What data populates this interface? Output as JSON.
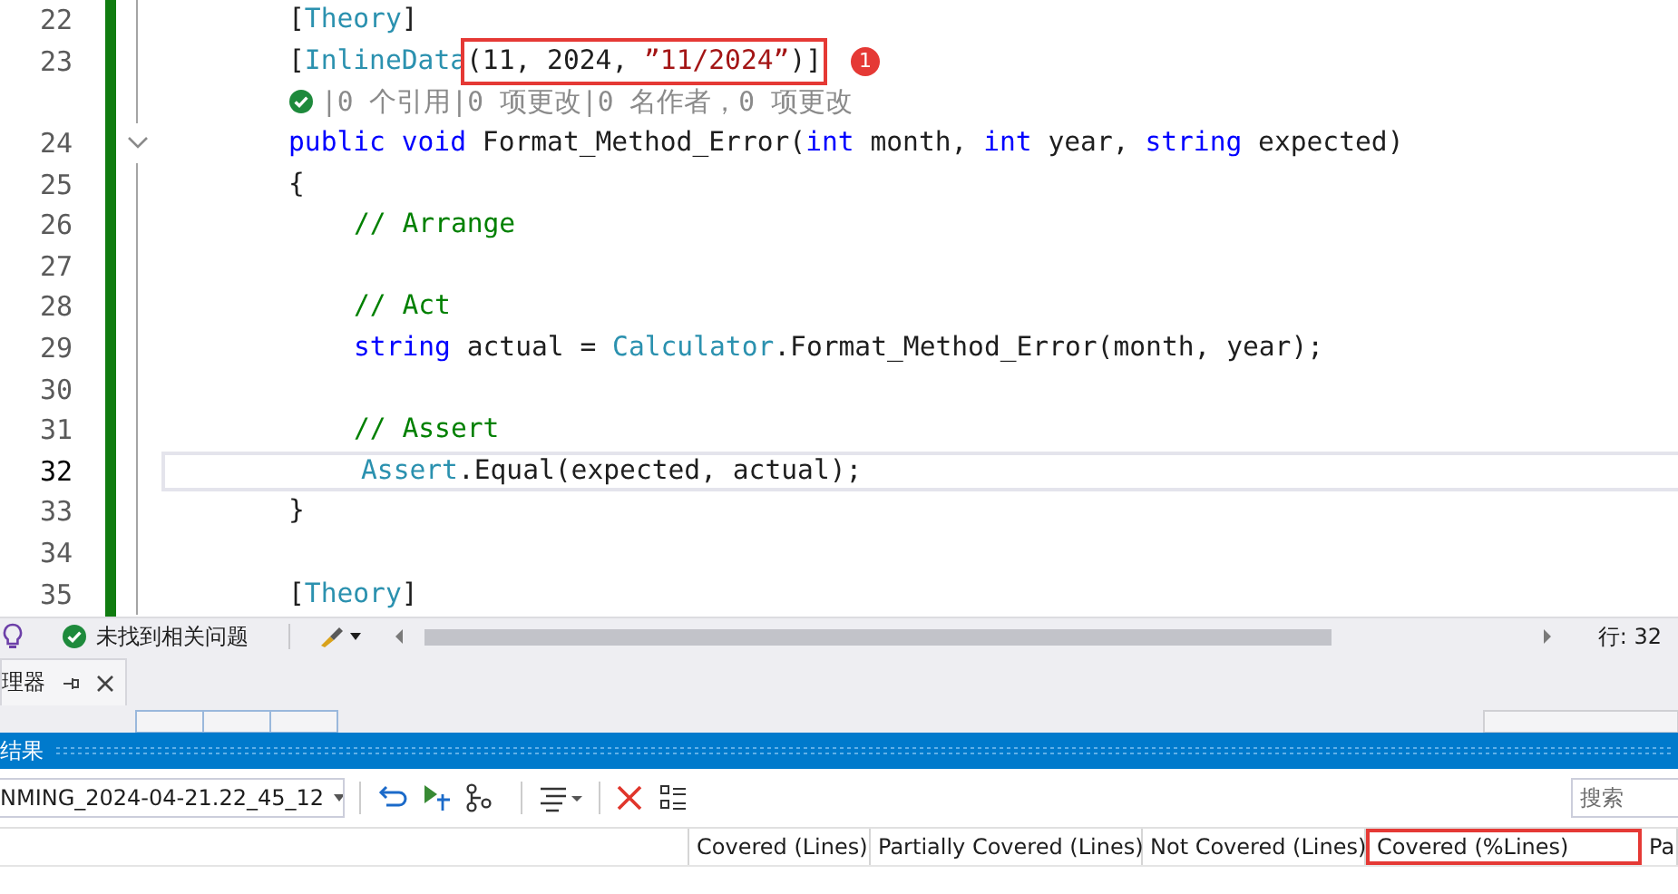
{
  "editor": {
    "lines": [
      {
        "number": "22",
        "kind": "member",
        "current": false,
        "segments": [
          {
            "boxed": false,
            "tokens": [
              {
                "text": "[",
                "kind": "punct"
              },
              {
                "text": "Theory",
                "kind": "type"
              },
              {
                "text": "]",
                "kind": "punct"
              }
            ]
          }
        ]
      },
      {
        "number": "23",
        "kind": "member",
        "current": false,
        "badge": "1",
        "segments": [
          {
            "boxed": false,
            "tokens": [
              {
                "text": "[",
                "kind": "punct"
              },
              {
                "text": "InlineData",
                "kind": "type"
              }
            ]
          },
          {
            "boxed": true,
            "tokens": [
              {
                "text": "(11, 2024, ",
                "kind": "plain"
              },
              {
                "text": "”11/2024”",
                "kind": "string"
              },
              {
                "text": ")]",
                "kind": "plain"
              }
            ]
          }
        ]
      },
      {
        "kind": "codelens",
        "current": false,
        "text": "|0 个引用|0 项更改|0 名作者，0 项更改"
      },
      {
        "number": "24",
        "kind": "member",
        "current": false,
        "expanded": true,
        "segments": [
          {
            "boxed": false,
            "tokens": [
              {
                "text": "public",
                "kind": "keyword"
              },
              {
                "text": " void",
                "kind": "keyword"
              },
              {
                "text": " Format_Method_Error(",
                "kind": "plain"
              },
              {
                "text": "int",
                "kind": "keyword"
              },
              {
                "text": " month, ",
                "kind": "plain"
              },
              {
                "text": "int",
                "kind": "keyword"
              },
              {
                "text": " year, ",
                "kind": "plain"
              },
              {
                "text": "string",
                "kind": "keyword"
              },
              {
                "text": " expected)",
                "kind": "plain"
              }
            ]
          }
        ]
      },
      {
        "number": "25",
        "kind": "member",
        "current": false,
        "segments": [
          {
            "boxed": false,
            "tokens": [
              {
                "text": "{",
                "kind": "plain"
              }
            ]
          }
        ]
      },
      {
        "number": "26",
        "kind": "body",
        "current": false,
        "segments": [
          {
            "boxed": false,
            "tokens": [
              {
                "text": "// Arrange",
                "kind": "comment"
              }
            ]
          }
        ]
      },
      {
        "number": "27",
        "kind": "blank",
        "current": false
      },
      {
        "number": "28",
        "kind": "body",
        "current": false,
        "segments": [
          {
            "boxed": false,
            "tokens": [
              {
                "text": "// Act",
                "kind": "comment"
              }
            ]
          }
        ]
      },
      {
        "number": "29",
        "kind": "body",
        "current": false,
        "segments": [
          {
            "boxed": false,
            "tokens": [
              {
                "text": "string",
                "kind": "keyword"
              },
              {
                "text": " actual = ",
                "kind": "plain"
              },
              {
                "text": "Calculator",
                "kind": "type"
              },
              {
                "text": ".Format_Method_Error(month, year);",
                "kind": "plain"
              }
            ]
          }
        ]
      },
      {
        "number": "30",
        "kind": "blank",
        "current": false
      },
      {
        "number": "31",
        "kind": "body",
        "current": false,
        "segments": [
          {
            "boxed": false,
            "tokens": [
              {
                "text": "// Assert",
                "kind": "comment"
              }
            ]
          }
        ]
      },
      {
        "number": "32",
        "kind": "body",
        "current": true,
        "segments": [
          {
            "boxed": false,
            "tokens": [
              {
                "text": "Assert",
                "kind": "type"
              },
              {
                "text": ".Equal(expected, actual);",
                "kind": "plain"
              }
            ]
          }
        ]
      },
      {
        "number": "33",
        "kind": "member",
        "current": false,
        "segments": [
          {
            "boxed": false,
            "tokens": [
              {
                "text": "}",
                "kind": "plain"
              }
            ]
          }
        ]
      },
      {
        "number": "34",
        "kind": "blank",
        "current": false
      },
      {
        "number": "35",
        "kind": "member",
        "current": false,
        "segments": [
          {
            "boxed": false,
            "tokens": [
              {
                "text": "[",
                "kind": "punct"
              },
              {
                "text": "Theory",
                "kind": "type"
              },
              {
                "text": "]",
                "kind": "punct"
              }
            ]
          }
        ]
      }
    ]
  },
  "status_bar": {
    "issues": "未找到相关问题",
    "position": "行: 32"
  },
  "panel": {
    "tab": "理器",
    "title": "结果",
    "run_selector": "NMING_2024-04-21.22_45_12",
    "search": {
      "placeholder": "搜索"
    },
    "columns": [
      {
        "highlighted": false
      },
      {
        "label": "Covered (Lines)",
        "highlighted": false
      },
      {
        "label": "Partially Covered (Lines)",
        "highlighted": false
      },
      {
        "label": "Not Covered (Lines)",
        "highlighted": false
      },
      {
        "label": "Covered (%Lines)",
        "highlighted": true
      },
      {
        "label": "Pa",
        "highlighted": false
      }
    ]
  }
}
